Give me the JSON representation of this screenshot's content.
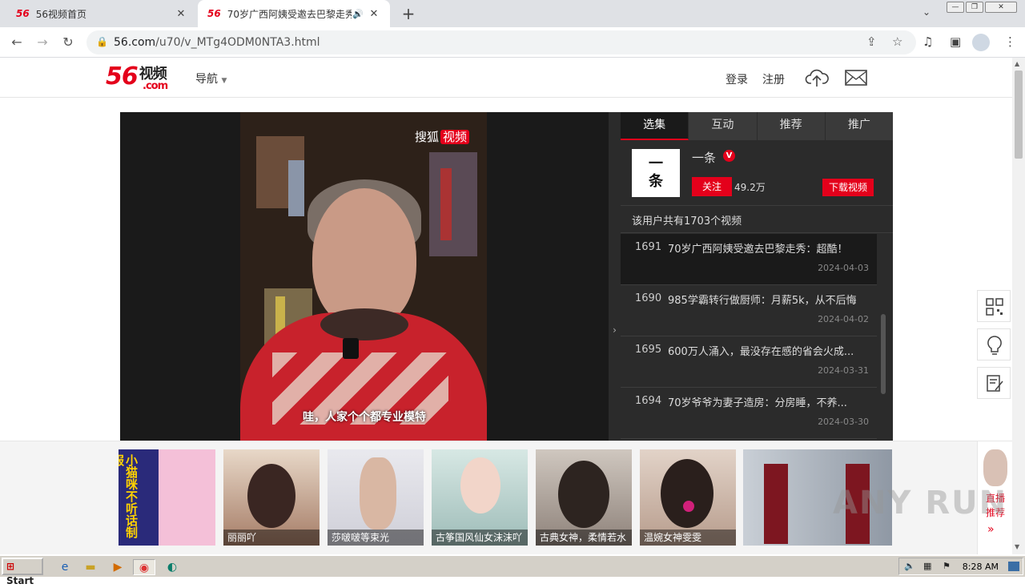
{
  "browser": {
    "tabs": [
      {
        "favicon": "56",
        "title": "56视频首页",
        "active": false
      },
      {
        "favicon": "56",
        "title": "70岁广西阿姨受邀去巴黎走秀",
        "active": true
      }
    ],
    "url_host": "56.com",
    "url_path": "/u70/v_MTg4ODM0NTA3.html"
  },
  "header": {
    "logo_num": "56",
    "logo_cn": "视频",
    "logo_com": ".com",
    "nav_label": "导航",
    "login": "登录",
    "register": "注册"
  },
  "player": {
    "watermark": "搜狐",
    "watermark_badge": "视频",
    "subtitle": "哇，人家个个都专业模特"
  },
  "panel": {
    "tabs": [
      "选集",
      "互动",
      "推荐",
      "推广"
    ],
    "author": {
      "avatar_text_1": "一",
      "avatar_text_2": "条",
      "name": "一条",
      "verified_badge": "V",
      "follow": "关注",
      "fans": "49.2万",
      "download": "下载视频"
    },
    "count_text": "该用户共有1703个视频",
    "videos": [
      {
        "num": "1691",
        "title": "70岁广西阿姨受邀去巴黎走秀：超酷！",
        "date": "2024-04-03",
        "active": true
      },
      {
        "num": "1690",
        "title": "985学霸转行做厨师：月薪5k，从不后悔",
        "date": "2024-04-02",
        "active": false
      },
      {
        "num": "1695",
        "title": "600万人涌入，最没存在感的省会火成...",
        "date": "2024-03-31",
        "active": false
      },
      {
        "num": "1694",
        "title": "70岁爷爷为妻子造房：分房睡，不养...",
        "date": "2024-03-30",
        "active": false
      }
    ]
  },
  "strip": {
    "cards": [
      {
        "caption": "",
        "art": "小猫咪不听话制服"
      },
      {
        "caption": "丽丽吖"
      },
      {
        "caption": "莎啵啵等束光"
      },
      {
        "caption": "古筝国风仙女沫沫吖"
      },
      {
        "caption": "古典女神，柔情若水"
      },
      {
        "caption": "温婉女神雯雯"
      },
      {
        "caption": ""
      }
    ],
    "live_label": "直播推荐"
  },
  "watermark_text": "ANY RUN",
  "taskbar": {
    "start": "Start",
    "clock": "8:28 AM"
  },
  "colors": {
    "brand_red": "#e4001b",
    "panel_bg": "#2b2b2b",
    "panel_active": "#1a1a1a"
  }
}
